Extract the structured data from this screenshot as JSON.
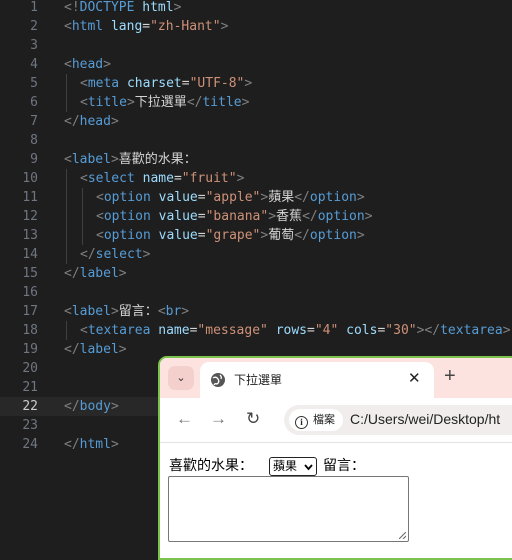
{
  "editor": {
    "active_line": 22,
    "lines": [
      {
        "n": "1",
        "segs": [
          [
            "br",
            "<!"
          ],
          [
            "tag",
            "DOCTYPE"
          ],
          [
            "txt",
            " "
          ],
          [
            "attr",
            "html"
          ],
          [
            "br",
            ">"
          ]
        ]
      },
      {
        "n": "2",
        "segs": [
          [
            "br",
            "<"
          ],
          [
            "tag",
            "html"
          ],
          [
            "txt",
            " "
          ],
          [
            "attr",
            "lang"
          ],
          [
            "txt",
            "="
          ],
          [
            "str",
            "\"zh-Hant\""
          ],
          [
            "br",
            ">"
          ]
        ]
      },
      {
        "n": "3",
        "segs": []
      },
      {
        "n": "4",
        "segs": [
          [
            "br",
            "<"
          ],
          [
            "tag",
            "head"
          ],
          [
            "br",
            ">"
          ]
        ]
      },
      {
        "n": "5",
        "indent": 1,
        "segs": [
          [
            "br",
            "<"
          ],
          [
            "tag",
            "meta"
          ],
          [
            "txt",
            " "
          ],
          [
            "attr",
            "charset"
          ],
          [
            "txt",
            "="
          ],
          [
            "str",
            "\"UTF-8\""
          ],
          [
            "br",
            ">"
          ]
        ]
      },
      {
        "n": "6",
        "indent": 1,
        "segs": [
          [
            "br",
            "<"
          ],
          [
            "tag",
            "title"
          ],
          [
            "br",
            ">"
          ],
          [
            "cjk",
            "下拉選單"
          ],
          [
            "br",
            "</"
          ],
          [
            "tag",
            "title"
          ],
          [
            "br",
            ">"
          ]
        ]
      },
      {
        "n": "7",
        "segs": [
          [
            "br",
            "</"
          ],
          [
            "tag",
            "head"
          ],
          [
            "br",
            ">"
          ]
        ]
      },
      {
        "n": "8",
        "segs": []
      },
      {
        "n": "9",
        "segs": [
          [
            "br",
            "<"
          ],
          [
            "tag",
            "label"
          ],
          [
            "br",
            ">"
          ],
          [
            "cjk",
            "喜歡的水果："
          ]
        ]
      },
      {
        "n": "10",
        "indent": 1,
        "segs": [
          [
            "br",
            "<"
          ],
          [
            "tag",
            "select"
          ],
          [
            "txt",
            " "
          ],
          [
            "attr",
            "name"
          ],
          [
            "txt",
            "="
          ],
          [
            "str",
            "\"fruit\""
          ],
          [
            "br",
            ">"
          ]
        ]
      },
      {
        "n": "11",
        "indent": 2,
        "segs": [
          [
            "br",
            "<"
          ],
          [
            "tag",
            "option"
          ],
          [
            "txt",
            " "
          ],
          [
            "attr",
            "value"
          ],
          [
            "txt",
            "="
          ],
          [
            "str",
            "\"apple\""
          ],
          [
            "br",
            ">"
          ],
          [
            "cjk",
            "蘋果"
          ],
          [
            "br",
            "</"
          ],
          [
            "tag",
            "option"
          ],
          [
            "br",
            ">"
          ]
        ]
      },
      {
        "n": "12",
        "indent": 2,
        "segs": [
          [
            "br",
            "<"
          ],
          [
            "tag",
            "option"
          ],
          [
            "txt",
            " "
          ],
          [
            "attr",
            "value"
          ],
          [
            "txt",
            "="
          ],
          [
            "str",
            "\"banana\""
          ],
          [
            "br",
            ">"
          ],
          [
            "cjk",
            "香蕉"
          ],
          [
            "br",
            "</"
          ],
          [
            "tag",
            "option"
          ],
          [
            "br",
            ">"
          ]
        ]
      },
      {
        "n": "13",
        "indent": 2,
        "segs": [
          [
            "br",
            "<"
          ],
          [
            "tag",
            "option"
          ],
          [
            "txt",
            " "
          ],
          [
            "attr",
            "value"
          ],
          [
            "txt",
            "="
          ],
          [
            "str",
            "\"grape\""
          ],
          [
            "br",
            ">"
          ],
          [
            "cjk",
            "葡萄"
          ],
          [
            "br",
            "</"
          ],
          [
            "tag",
            "option"
          ],
          [
            "br",
            ">"
          ]
        ]
      },
      {
        "n": "14",
        "indent": 1,
        "segs": [
          [
            "br",
            "</"
          ],
          [
            "tag",
            "select"
          ],
          [
            "br",
            ">"
          ]
        ]
      },
      {
        "n": "15",
        "segs": [
          [
            "br",
            "</"
          ],
          [
            "tag",
            "label"
          ],
          [
            "br",
            ">"
          ]
        ]
      },
      {
        "n": "16",
        "segs": []
      },
      {
        "n": "17",
        "segs": [
          [
            "br",
            "<"
          ],
          [
            "tag",
            "label"
          ],
          [
            "br",
            ">"
          ],
          [
            "cjk",
            "留言："
          ],
          [
            "br",
            "<"
          ],
          [
            "tag",
            "br"
          ],
          [
            "br",
            ">"
          ]
        ]
      },
      {
        "n": "18",
        "indent": 1,
        "segs": [
          [
            "br",
            "<"
          ],
          [
            "tag",
            "textarea"
          ],
          [
            "txt",
            " "
          ],
          [
            "attr",
            "name"
          ],
          [
            "txt",
            "="
          ],
          [
            "str",
            "\"message\""
          ],
          [
            "txt",
            " "
          ],
          [
            "attr",
            "rows"
          ],
          [
            "txt",
            "="
          ],
          [
            "str",
            "\"4\""
          ],
          [
            "txt",
            " "
          ],
          [
            "attr",
            "cols"
          ],
          [
            "txt",
            "="
          ],
          [
            "str",
            "\"30\""
          ],
          [
            "br",
            "></"
          ],
          [
            "tag",
            "textarea"
          ],
          [
            "br",
            ">"
          ]
        ]
      },
      {
        "n": "19",
        "segs": [
          [
            "br",
            "</"
          ],
          [
            "tag",
            "label"
          ],
          [
            "br",
            ">"
          ]
        ]
      },
      {
        "n": "20",
        "segs": []
      },
      {
        "n": "21",
        "segs": []
      },
      {
        "n": "22",
        "segs": [
          [
            "br",
            "</"
          ],
          [
            "tag",
            "body"
          ],
          [
            "br",
            ">"
          ]
        ]
      },
      {
        "n": "23",
        "segs": []
      },
      {
        "n": "24",
        "segs": [
          [
            "br",
            "</"
          ],
          [
            "tag",
            "html"
          ],
          [
            "br",
            ">"
          ]
        ]
      }
    ]
  },
  "colors": {
    "editor_bg": "#1e1e1e",
    "tag": "#569cd6",
    "attr": "#9cdcfe",
    "string": "#ce9178",
    "bracket": "#808080",
    "text": "#d4d4d4",
    "tabstrip": "#fce3e0",
    "window_border": "#7bc24f"
  },
  "browser": {
    "tab_title": "下拉選單",
    "tab_close": "✕",
    "new_tab": "+",
    "tab_dropdown": "⌄",
    "back": "←",
    "forward": "→",
    "reload": "↻",
    "info_chip_label": "檔案",
    "info_icon": "i",
    "url": "C:/Users/wei/Desktop/ht"
  },
  "page": {
    "fruit_label": "喜歡的水果：",
    "fruit_selected": "蘋果",
    "message_label": "留言：",
    "message_value": ""
  }
}
